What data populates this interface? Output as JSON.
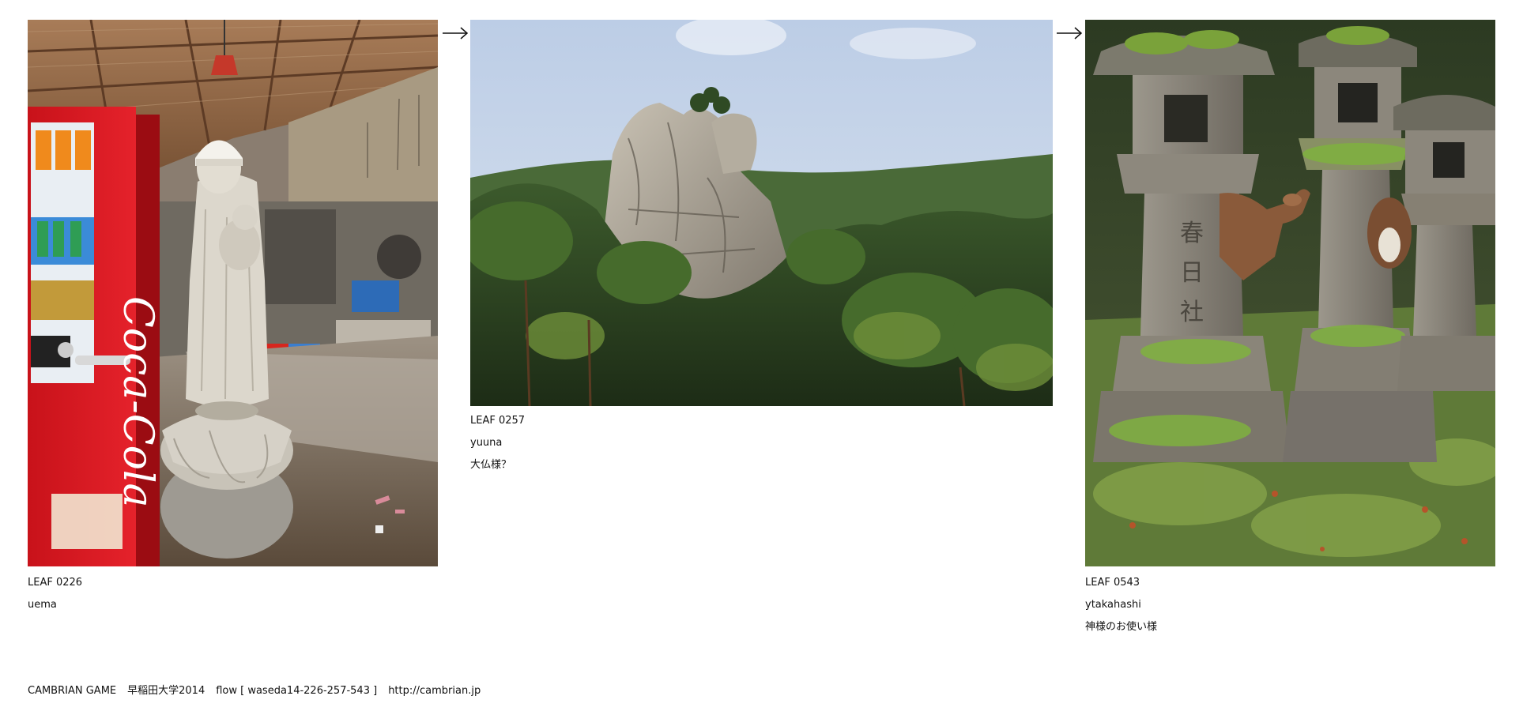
{
  "leaves": [
    {
      "id": "LEAF 0226",
      "author": "uema",
      "title": "",
      "image_subject": "stone jizo statue beside vending machine under shed"
    },
    {
      "id": "LEAF 0257",
      "author": "yuuna",
      "title": "大仏様？",
      "image_subject": "rocky crag peak above pine forest"
    },
    {
      "id": "LEAF 0543",
      "author": "ytakahashi",
      "title": "神様のお使い様",
      "image_subject": "mossy stone lanterns with deer"
    }
  ],
  "flow_arrow": "arrow-right-icon",
  "footer": {
    "game": "CAMBRIAN GAME",
    "event": "早稲田大学2014",
    "flow": "flow [ waseda14-226-257-543 ]",
    "url": "http://cambrian.jp"
  }
}
